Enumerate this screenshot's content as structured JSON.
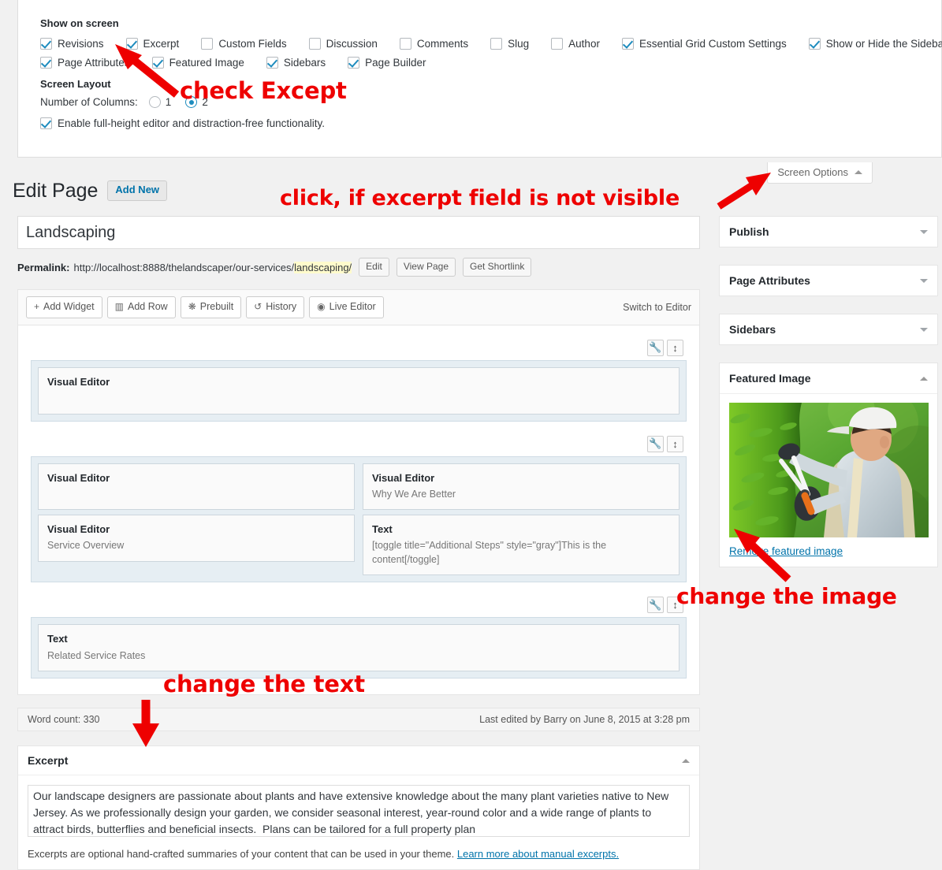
{
  "screen_options": {
    "tab_label": "Screen Options",
    "tab_caret": "caret-up-icon",
    "show_on_screen_heading": "Show on screen",
    "checkboxes_row1": [
      {
        "label": "Revisions",
        "checked": true
      },
      {
        "label": "Excerpt",
        "checked": true
      },
      {
        "label": "Custom Fields",
        "checked": false
      },
      {
        "label": "Discussion",
        "checked": false
      },
      {
        "label": "Comments",
        "checked": false
      },
      {
        "label": "Slug",
        "checked": false
      },
      {
        "label": "Author",
        "checked": false
      },
      {
        "label": "Essential Grid Custom Settings",
        "checked": true
      },
      {
        "label": "Show or Hide the Sidebar",
        "checked": true
      }
    ],
    "checkboxes_row2": [
      {
        "label": "Page Attributes",
        "checked": true
      },
      {
        "label": "Featured Image",
        "checked": true
      },
      {
        "label": "Sidebars",
        "checked": true
      },
      {
        "label": "Page Builder",
        "checked": true
      }
    ],
    "screen_layout_heading": "Screen Layout",
    "number_of_columns_label": "Number of Columns:",
    "column_options": [
      {
        "label": "1",
        "selected": false
      },
      {
        "label": "2",
        "selected": true
      }
    ],
    "fullheight_label": "Enable full-height editor and distraction-free functionality.",
    "fullheight_checked": true
  },
  "page_header": {
    "title": "Edit Page",
    "add_new_label": "Add New"
  },
  "editor": {
    "title_value": "Landscaping",
    "permalink_label": "Permalink:",
    "permalink_base": "http://localhost:8888/thelandscaper/our-services/",
    "permalink_slug": "landscaping/",
    "buttons": [
      "Edit",
      "View Page",
      "Get Shortlink"
    ]
  },
  "page_builder": {
    "toolbar": [
      {
        "label": "Add Widget",
        "icon": "plus-icon",
        "glyph": "+"
      },
      {
        "label": "Add Row",
        "icon": "columns-icon",
        "glyph": "▥"
      },
      {
        "label": "Prebuilt",
        "icon": "clone-icon",
        "glyph": "❋"
      },
      {
        "label": "History",
        "icon": "history-icon",
        "glyph": "↺"
      },
      {
        "label": "Live Editor",
        "icon": "eye-icon",
        "glyph": "◉"
      }
    ],
    "switch_to_editor": "Switch to Editor",
    "row_control_icons": [
      {
        "name": "wrench-icon",
        "glyph": "🔧"
      },
      {
        "name": "move-vertical-icon",
        "glyph": "↕"
      }
    ],
    "rows": [
      {
        "columns": [
          {
            "widgets": [
              {
                "title": "Visual Editor",
                "subtitle": ""
              }
            ]
          }
        ]
      },
      {
        "columns": [
          {
            "widgets": [
              {
                "title": "Visual Editor",
                "subtitle": ""
              },
              {
                "title": "Visual Editor",
                "subtitle": "Service Overview"
              }
            ]
          },
          {
            "widgets": [
              {
                "title": "Visual Editor",
                "subtitle": "Why We Are Better"
              },
              {
                "title": "Text",
                "subtitle": "[toggle title=\"Additional Steps\" style=\"gray\"]This is the content[/toggle]"
              }
            ]
          }
        ]
      },
      {
        "columns": [
          {
            "widgets": [
              {
                "title": "Text",
                "subtitle": "Related Service Rates"
              }
            ]
          }
        ]
      }
    ]
  },
  "word_count_bar": {
    "word_count": "Word count: 330",
    "last_edited": "Last edited by Barry on June 8, 2015 at 3:28 pm"
  },
  "excerpt_box": {
    "title": "Excerpt",
    "toggle_icon": "caret-up-icon",
    "value": "Our landscape designers are passionate about plants and have extensive knowledge about the many plant varieties native to New Jersey. As we professionally design your garden, we consider seasonal interest, year-round color and a wide range of plants to attract birds, butterflies and beneficial insects.  Plans can be tailored for a full property plan",
    "note_text": "Excerpts are optional hand-crafted summaries of your content that can be used in your theme. ",
    "note_link": "Learn more about manual excerpts."
  },
  "sidebar": {
    "boxes": [
      {
        "title": "Publish",
        "state": "collapsed",
        "toggle_icon": "caret-down-icon"
      },
      {
        "title": "Page Attributes",
        "state": "collapsed",
        "toggle_icon": "caret-down-icon"
      },
      {
        "title": "Sidebars",
        "state": "collapsed",
        "toggle_icon": "caret-down-icon"
      },
      {
        "title": "Featured Image",
        "state": "expanded",
        "toggle_icon": "caret-up-icon"
      }
    ],
    "featured_image": {
      "alt": "Landscaper in white cap trimming a green hedge with shears",
      "remove_link": "Remove featured image"
    }
  },
  "annotations": [
    {
      "id": "check-except",
      "text": "check Except"
    },
    {
      "id": "click-excerpt",
      "text": "click, if excerpt field is not visible"
    },
    {
      "id": "change-image",
      "text": "change the image"
    },
    {
      "id": "change-text",
      "text": "change the text"
    }
  ],
  "colors": {
    "annotation_red": "#ee0000",
    "accent_blue": "#0073aa",
    "checkbox_blue": "#1e8cbe",
    "page_bg": "#f1f1f1",
    "panel_border": "#e5e5e5",
    "row_bg": "#e6eef3",
    "slug_highlight": "#fffbcc"
  }
}
